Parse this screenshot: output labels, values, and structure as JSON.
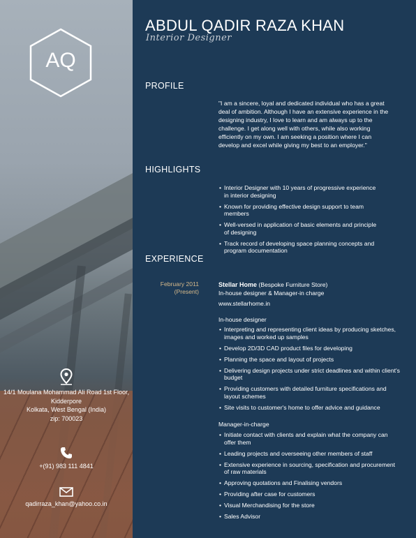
{
  "header": {
    "name": "ABDUL QADIR RAZA KHAN",
    "role": "Interior Designer",
    "monogram": "AQ"
  },
  "contact": {
    "address_icon": "location-pin-icon",
    "address_lines": [
      "14/1 Moulana Mohammad Ali Road 1st Floor,",
      "Kidderpore",
      "Kolkata, West Bengal (India)",
      "zip: 700023"
    ],
    "phone_icon": "phone-icon",
    "phone": "+(91) 983 111 4841",
    "email_icon": "envelope-icon",
    "email": "qadirraza_khan@yahoo.co.in"
  },
  "profile": {
    "heading": "PROFILE",
    "text": "\"I am a sincere, loyal and dedicated individual who has a great deal of ambition. Although I have an extensive experience in the designing industry, I love to learn and am always up to the challenge. I get along well with others, while also working efficiently on my own. I am seeking a position where I can develop and excel while giving my best to an employer.\""
  },
  "highlights": {
    "heading": "HIGHLIGHTS",
    "items": [
      "Interior Designer with 10 years of progressive experience in interior designing",
      "Known for providing effective design support to team members",
      "Well-versed in application of basic elements and principle of designing",
      "Track record of developing space planning concepts and program documentation"
    ]
  },
  "experience": {
    "heading": "EXPERIENCE",
    "date": "February 2011",
    "date_note": "(Present)",
    "company": "Stellar Home",
    "company_desc": "(Bespoke Furniture Store)",
    "position": "In-house designer & Manager-in charge",
    "website": "www.stellarhome.in",
    "section1_title": "In-house designer",
    "section1_items": [
      "Interpreting and representing client ideas by producing sketches, images and worked up samples",
      "Develop 2D/3D CAD product files for developing",
      "Planning the space and layout of projects",
      "Delivering design projects under strict deadlines and within client's budget",
      "Providing customers with detailed furniture specifications and layout schemes",
      "Site visits to customer's home to offer advice and guidance"
    ],
    "section2_title": "Manager-in-charge",
    "section2_items": [
      "Initiate contact with clients and explain what the company can offer them",
      "Leading projects and overseeing other members of staff",
      "Extensive experience in sourcing, specification and procurement of raw materials",
      "Approving quotations and Finalising vendors",
      "Providing after case for customers",
      "Visual Merchandising for the store",
      "Sales Advisor"
    ]
  }
}
